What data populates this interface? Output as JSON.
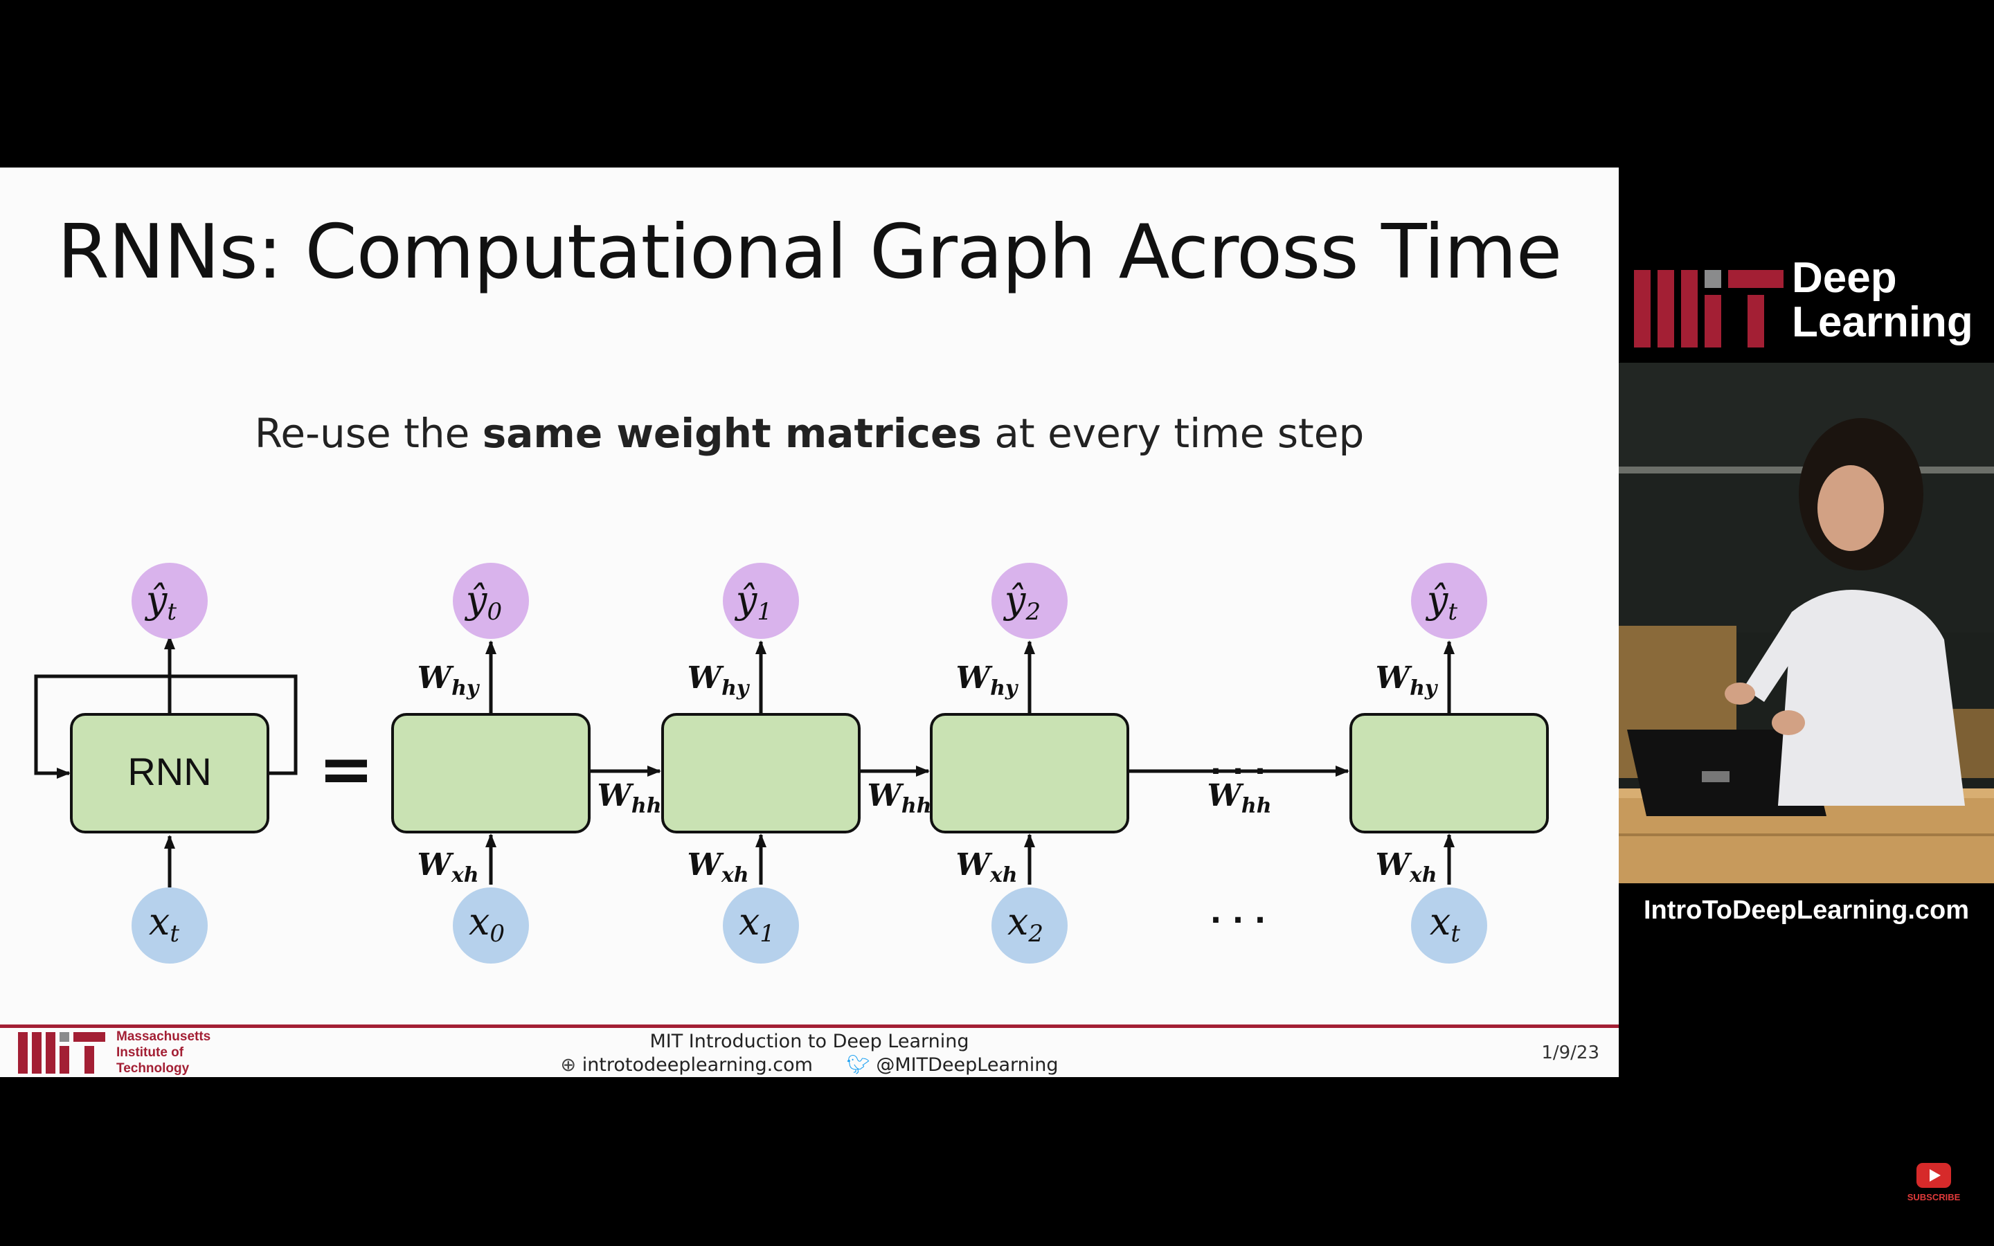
{
  "slide": {
    "title": "RNNs: Computational Graph Across Time",
    "subtitle_pre": "Re-use the ",
    "subtitle_bold": "same weight matrices",
    "subtitle_post": " at every time step",
    "rnn_label": "RNN",
    "equals": "=",
    "ellipsis": "· · ·",
    "weights": {
      "hy": "hy",
      "hh": "hh",
      "xh": "xh",
      "W": "W"
    },
    "left_nodes": {
      "input_base": "x",
      "input_sub": "t",
      "output_base": "ŷ",
      "output_sub": "t"
    },
    "timesteps": [
      {
        "input_base": "x",
        "input_sub": "0",
        "output_base": "ŷ",
        "output_sub": "0"
      },
      {
        "input_base": "x",
        "input_sub": "1",
        "output_base": "ŷ",
        "output_sub": "1"
      },
      {
        "input_base": "x",
        "input_sub": "2",
        "output_base": "ŷ",
        "output_sub": "2"
      },
      {
        "input_base": "x",
        "input_sub": "t",
        "output_base": "ŷ",
        "output_sub": "t"
      }
    ],
    "colors": {
      "cell_fill": "#c9e2b3",
      "output_fill": "#d9b3ec",
      "input_fill": "#b6d1ec",
      "mit_red": "#a31f34"
    }
  },
  "footer": {
    "course": "MIT Introduction to Deep Learning",
    "website": "introtodeeplearning.com",
    "twitter": "@MITDeepLearning",
    "date": "1/9/23",
    "institution_lines": [
      "Massachusetts",
      "Institute of",
      "Technology"
    ]
  },
  "side_panel": {
    "brand_line1": "Deep",
    "brand_line2": "Learning",
    "url": "IntroToDeepLearning.com"
  },
  "player": {
    "subscribe_label": "SUBSCRIBE",
    "icons": [
      "prev-slide-icon",
      "pen-icon",
      "slides-icon",
      "camera-icon",
      "zoom-icon",
      "more-icon"
    ]
  }
}
